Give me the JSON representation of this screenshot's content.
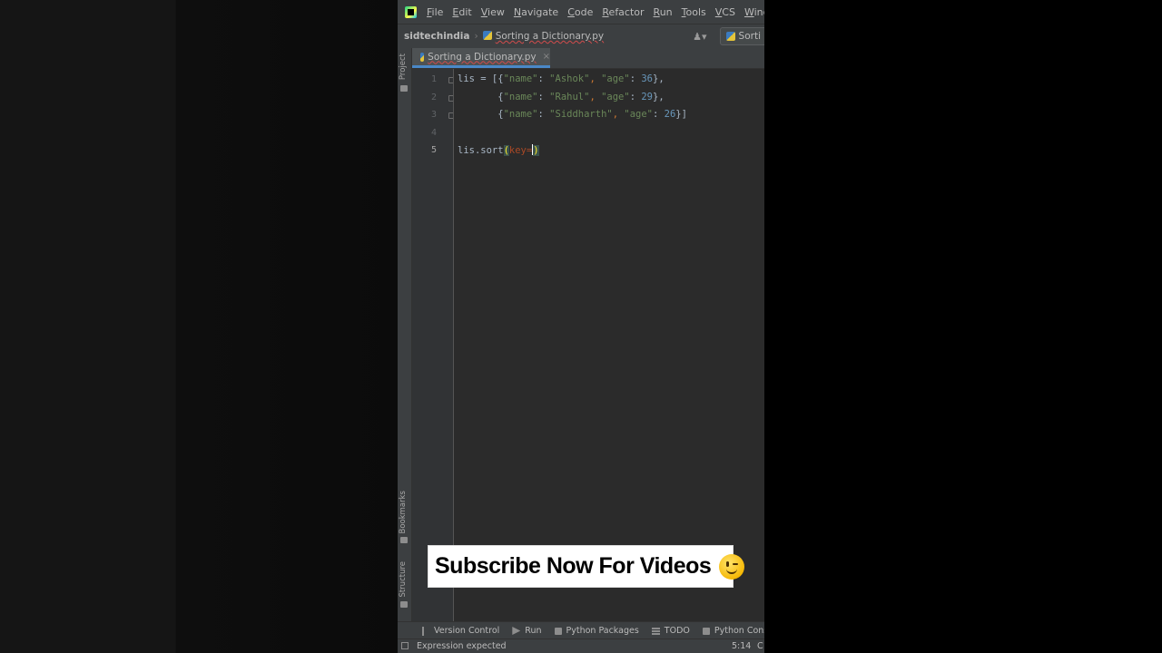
{
  "menu": {
    "items": [
      {
        "first": "F",
        "rest": "ile"
      },
      {
        "first": "E",
        "rest": "dit"
      },
      {
        "first": "V",
        "rest": "iew"
      },
      {
        "first": "N",
        "rest": "avigate"
      },
      {
        "first": "C",
        "rest": "ode"
      },
      {
        "first": "R",
        "rest": "efactor"
      },
      {
        "first": "R",
        "rest": "un"
      },
      {
        "first": "T",
        "rest": "ools"
      },
      {
        "first": "V",
        "rest": "CS"
      },
      {
        "first": "W",
        "rest": "indow"
      }
    ]
  },
  "navbar": {
    "project": "sidtechindia",
    "file": "Sorting a Dictionary.py",
    "run_config": "Sorti"
  },
  "tab": {
    "label": "Sorting a Dictionary.py",
    "close": "×"
  },
  "toolstrip": {
    "project": "Project",
    "bookmarks": "Bookmarks",
    "structure": "Structure"
  },
  "editor": {
    "line_numbers": [
      "1",
      "2",
      "3",
      "4",
      "5"
    ],
    "active_line": 5,
    "lines": [
      [
        {
          "t": "lis = [{",
          "c": ""
        },
        {
          "t": "\"name\"",
          "c": "str"
        },
        {
          "t": ": ",
          "c": ""
        },
        {
          "t": "\"Ashok\"",
          "c": "str"
        },
        {
          "t": ", ",
          "c": "op"
        },
        {
          "t": "\"age\"",
          "c": "str"
        },
        {
          "t": ": ",
          "c": ""
        },
        {
          "t": "36",
          "c": "num"
        },
        {
          "t": "},",
          "c": ""
        }
      ],
      [
        {
          "t": "       {",
          "c": ""
        },
        {
          "t": "\"name\"",
          "c": "str"
        },
        {
          "t": ": ",
          "c": ""
        },
        {
          "t": "\"Rahul\"",
          "c": "str"
        },
        {
          "t": ", ",
          "c": "op"
        },
        {
          "t": "\"age\"",
          "c": "str"
        },
        {
          "t": ": ",
          "c": ""
        },
        {
          "t": "29",
          "c": "num"
        },
        {
          "t": "},",
          "c": ""
        }
      ],
      [
        {
          "t": "       {",
          "c": ""
        },
        {
          "t": "\"name\"",
          "c": "str"
        },
        {
          "t": ": ",
          "c": ""
        },
        {
          "t": "\"Siddharth\"",
          "c": "str"
        },
        {
          "t": ", ",
          "c": "op"
        },
        {
          "t": "\"age\"",
          "c": "str"
        },
        {
          "t": ": ",
          "c": ""
        },
        {
          "t": "26",
          "c": "num"
        },
        {
          "t": "}]",
          "c": ""
        }
      ],
      [],
      [
        {
          "t": "lis.sort",
          "c": ""
        },
        {
          "t": "(",
          "c": "paren-hl"
        },
        {
          "t": "key",
          "c": "kw"
        },
        {
          "t": "=",
          "c": "kw"
        },
        {
          "t": "|",
          "c": "caret"
        },
        {
          "t": ")",
          "c": "paren-hl"
        }
      ]
    ]
  },
  "banner": {
    "text": "Subscribe Now For Videos",
    "emoji": "winking-face"
  },
  "bottom_tools": [
    {
      "label": "Version Control",
      "icon": "vc"
    },
    {
      "label": "Run",
      "icon": "run"
    },
    {
      "label": "Python Packages",
      "icon": "sq"
    },
    {
      "label": "TODO",
      "icon": "bar"
    },
    {
      "label": "Python Cons",
      "icon": "sq"
    }
  ],
  "status": {
    "message": "Expression expected",
    "position": "5:14",
    "extra": "C"
  }
}
